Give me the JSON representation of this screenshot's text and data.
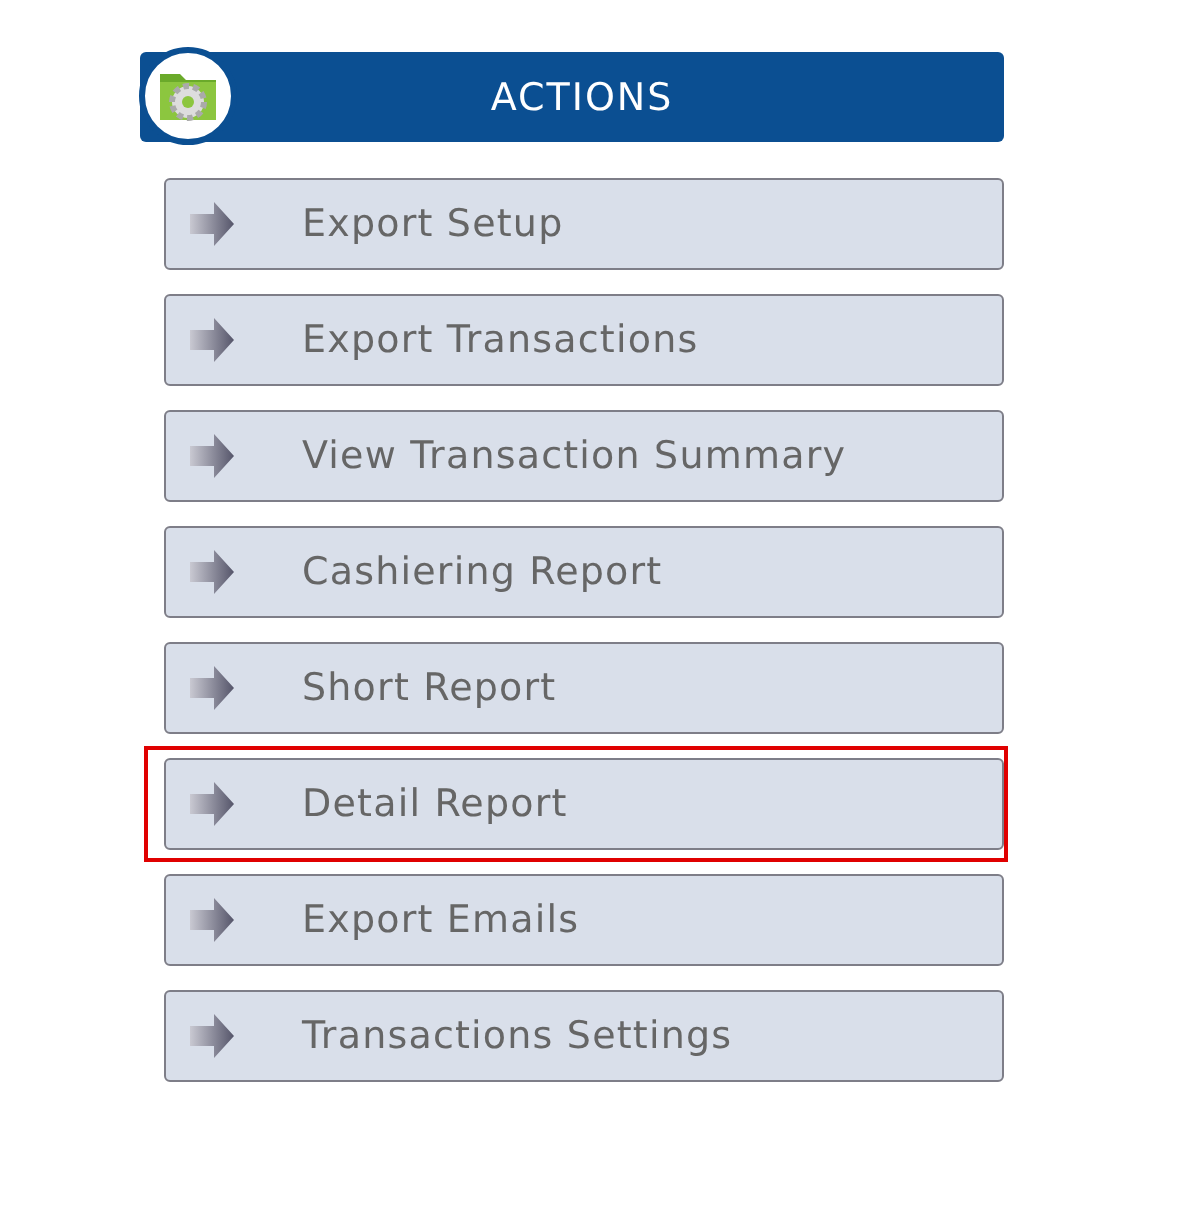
{
  "header": {
    "title": "ACTIONS"
  },
  "actions": [
    {
      "label": "Export Setup",
      "highlighted": false
    },
    {
      "label": "Export Transactions",
      "highlighted": false
    },
    {
      "label": "View Transaction Summary",
      "highlighted": false
    },
    {
      "label": "Cashiering Report",
      "highlighted": false
    },
    {
      "label": "Short Report",
      "highlighted": false
    },
    {
      "label": "Detail Report",
      "highlighted": true
    },
    {
      "label": "Export Emails",
      "highlighted": false
    },
    {
      "label": "Transactions Settings",
      "highlighted": false
    }
  ]
}
